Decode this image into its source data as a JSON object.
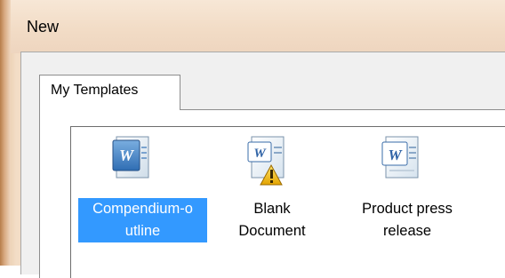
{
  "window": {
    "title": "New"
  },
  "tabs": [
    {
      "label": "My Templates"
    }
  ],
  "templates": [
    {
      "label": "Compendium-o\nutline",
      "icon": "word-document-icon",
      "selected": true
    },
    {
      "label": "Blank\nDocument",
      "icon": "word-blank-document-warning-icon",
      "selected": false
    },
    {
      "label": "Product press\nrelease",
      "icon": "word-document-icon",
      "selected": false
    }
  ],
  "colors": {
    "selection": "#3399ff",
    "frame": "#f2dcc6"
  }
}
